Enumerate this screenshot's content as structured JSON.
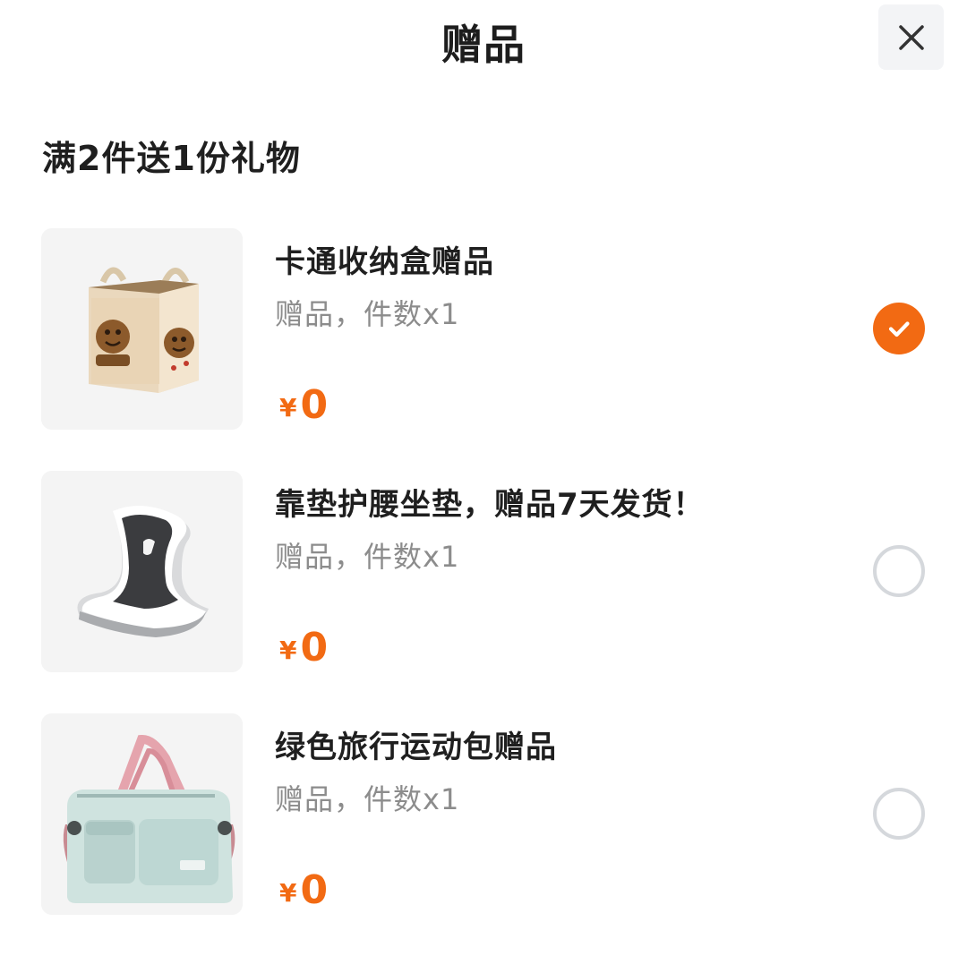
{
  "header": {
    "title": "赠品",
    "close_icon": "close-icon"
  },
  "promo": {
    "rule": "满2件送1份礼物"
  },
  "gifts": [
    {
      "name": "卡通收纳盒赠品",
      "meta": "赠品，件数x1",
      "price_symbol": "¥",
      "price": "0",
      "selected": true,
      "image_icon": "storage-box-image"
    },
    {
      "name": "靠垫护腰坐垫，赠品7天发货！",
      "meta": "赠品，件数x1",
      "price_symbol": "¥",
      "price": "0",
      "selected": false,
      "image_icon": "seat-cushion-image"
    },
    {
      "name": "绿色旅行运动包赠品",
      "meta": "赠品，件数x1",
      "price_symbol": "¥",
      "price": "0",
      "selected": false,
      "image_icon": "travel-bag-image"
    }
  ],
  "colors": {
    "accent": "#f26a13",
    "muted_text": "#8c8c8c",
    "radio_border": "#d5d8dc",
    "thumb_bg": "#f4f4f4"
  }
}
